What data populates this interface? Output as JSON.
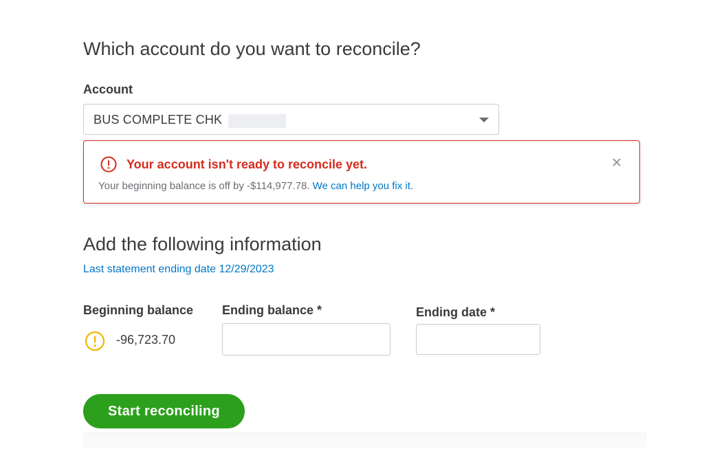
{
  "header": {
    "question": "Which account do you want to reconcile?"
  },
  "account": {
    "label": "Account",
    "selected_value": "BUS COMPLETE CHK"
  },
  "alert": {
    "title": "Your account isn't ready to reconcile yet.",
    "message": "Your beginning balance is off by -$114,977.78.",
    "link_text": "We can help you fix it.",
    "color": "#d52b1e"
  },
  "info": {
    "heading": "Add the following information",
    "last_statement": "Last statement ending date 12/29/2023"
  },
  "fields": {
    "beginning_balance_label": "Beginning balance",
    "beginning_balance_value": "-96,723.70",
    "ending_balance_label": "Ending balance *",
    "ending_balance_value": "",
    "ending_date_label": "Ending date *",
    "ending_date_value": ""
  },
  "actions": {
    "start_label": "Start reconciling",
    "primary_color": "#2ca01c"
  },
  "icons": {
    "alert": "error-circle-icon",
    "close": "close-icon",
    "warning": "warning-circle-icon",
    "dropdown": "chevron-down-icon"
  },
  "colors": {
    "link": "#0077c5",
    "warning": "#f2b600",
    "text": "#393a3d"
  }
}
